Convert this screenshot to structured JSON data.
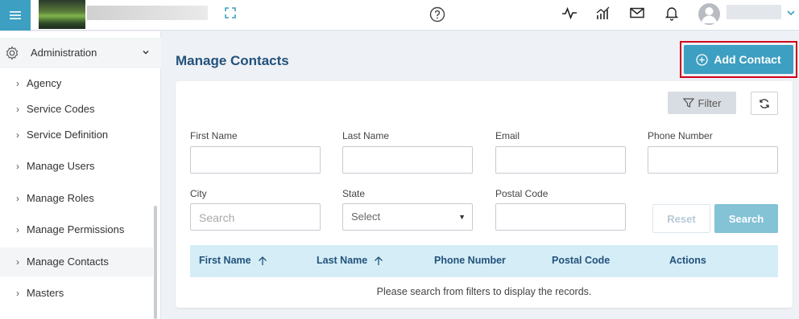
{
  "header": {
    "icons": [
      "menu-icon",
      "expand-icon",
      "help-icon",
      "activity-icon",
      "analytics-icon",
      "mail-icon",
      "bell-icon",
      "user-icon",
      "chevron-down-icon"
    ]
  },
  "sidebar": {
    "section_label": "Administration",
    "items": [
      {
        "label": "Agency"
      },
      {
        "label": "Service Codes"
      },
      {
        "label": "Service Definition"
      },
      {
        "label": "Manage Users"
      },
      {
        "label": "Manage Roles"
      },
      {
        "label": "Manage Permissions"
      },
      {
        "label": "Manage Contacts"
      },
      {
        "label": "Masters"
      }
    ]
  },
  "main": {
    "title": "Manage Contacts",
    "add_button_label": "Add Contact",
    "filter_label": "Filter",
    "fields": {
      "first_name_label": "First Name",
      "last_name_label": "Last Name",
      "email_label": "Email",
      "phone_label": "Phone Number",
      "city_label": "City",
      "city_placeholder": "Search",
      "state_label": "State",
      "state_selected": "Select",
      "postal_label": "Postal Code"
    },
    "reset_label": "Reset",
    "search_label": "Search",
    "table": {
      "columns": [
        "First Name",
        "Last Name",
        "Phone Number",
        "Postal Code",
        "Actions"
      ],
      "empty_message": "Please search from filters to display the records."
    }
  },
  "colors": {
    "accent": "#3d9fc1",
    "title": "#23527c",
    "highlight": "#d0021b"
  }
}
